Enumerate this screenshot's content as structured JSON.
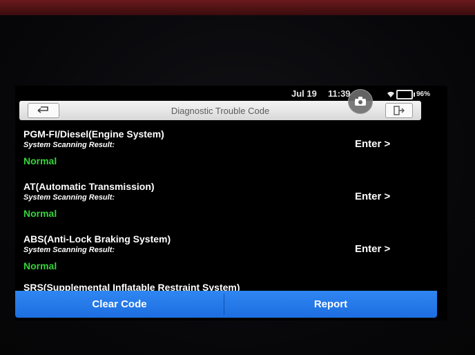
{
  "status": {
    "date": "Jul 19",
    "time": "11:39",
    "battery": "96%"
  },
  "header": {
    "title": "Diagnostic Trouble Code"
  },
  "systems": [
    {
      "name": "PGM-FI/Diesel(Engine System)",
      "scan_label": "System Scanning Result:",
      "result": "Normal",
      "action": "Enter >"
    },
    {
      "name": "AT(Automatic Transmission)",
      "scan_label": "System Scanning Result:",
      "result": "Normal",
      "action": "Enter >"
    },
    {
      "name": "ABS(Anti-Lock Braking System)",
      "scan_label": "System Scanning Result:",
      "result": "Normal",
      "action": "Enter >"
    }
  ],
  "partial_system": {
    "name": "SRS(Supplemental Inflatable Restraint System)"
  },
  "footer": {
    "clear_label": "Clear Code",
    "report_label": "Report"
  },
  "colors": {
    "accent": "#1d6ee0",
    "normal": "#35d43a",
    "background": "#000000"
  },
  "icons": [
    "back-icon",
    "exit-icon",
    "camera-icon",
    "wifi-icon",
    "battery-icon"
  ]
}
